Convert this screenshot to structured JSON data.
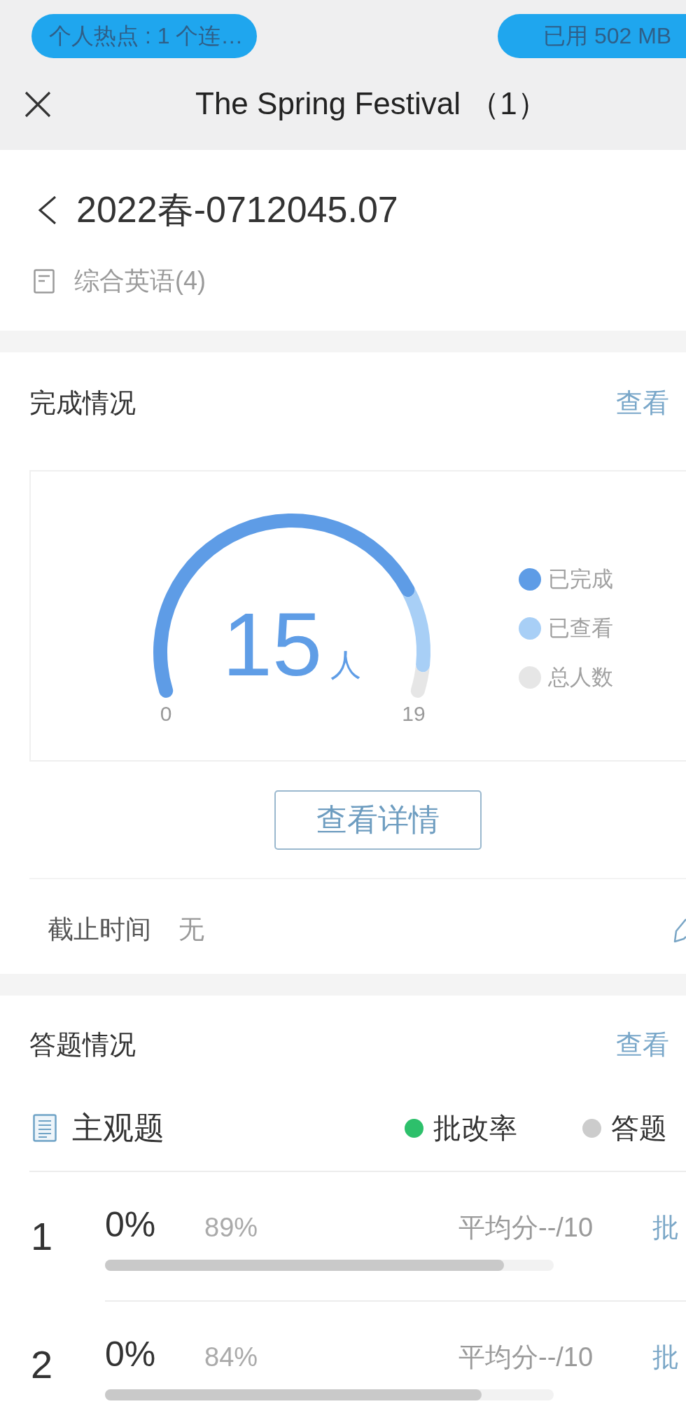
{
  "status_bar": {
    "hotspot": "个人热点 : 1 个连…",
    "data_usage": "已用 502 MB"
  },
  "title_bar": {
    "title": "The Spring Festival （1）"
  },
  "assignment": {
    "title": "2022春-0712045.07",
    "course": "综合英语(4)"
  },
  "completion": {
    "title": "完成情况",
    "link": "查看",
    "gauge": {
      "value": "15",
      "unit": "人",
      "min_label": "0",
      "max_label": "19",
      "chart_data": {
        "type": "donut",
        "values": [
          78.9,
          15.8,
          5.3
        ]
      },
      "legend": [
        {
          "label": "已完成",
          "color": "#5e9ce6"
        },
        {
          "label": "已查看",
          "color": "#a8cff6"
        },
        {
          "label": "总人数",
          "color": "#e6e6e6"
        }
      ]
    },
    "button": "查看详情",
    "deadline": {
      "label": "截止时间",
      "value": "无"
    }
  },
  "answers": {
    "title": "答题情况",
    "link": "查看",
    "group": {
      "title": "主观题",
      "legend": [
        {
          "label": "批改率",
          "color": "#2dc06b"
        },
        {
          "label": "答题",
          "color": "#cccccc"
        }
      ]
    },
    "rows": [
      {
        "number": "1",
        "grading_rate": "0%",
        "answer_rate": "89%",
        "level": 0.89,
        "average": "平均分--/10",
        "action": "批"
      },
      {
        "number": "2",
        "grading_rate": "0%",
        "answer_rate": "84%",
        "level": 0.84,
        "average": "平均分--/10",
        "action": "批"
      }
    ]
  }
}
